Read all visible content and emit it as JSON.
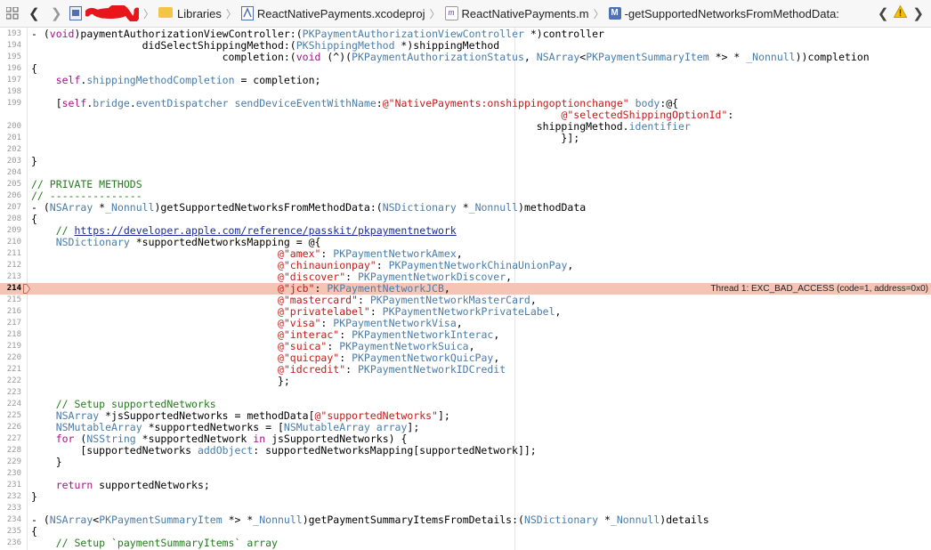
{
  "jumpbar": {
    "breadcrumbs": [
      "Libraries",
      "ReactNativePayments.xcodeproj",
      "ReactNativePayments.m",
      "-getSupportedNetworksFromMethodData:"
    ],
    "separator": "〉"
  },
  "error": {
    "line": "214",
    "message": "Thread 1: EXC_BAD_ACCESS (code=1, address=0x0)"
  },
  "colors": {
    "keyword": "#a7108b",
    "type": "#4a7ca9",
    "string": "#c41a16",
    "comment": "#267a1e",
    "error_highlight": "#f5c4b5"
  },
  "lines": [
    {
      "n": "193",
      "segs": [
        [
          "- (",
          "p"
        ],
        [
          "void",
          "kw"
        ],
        [
          ")paymentAuthorizationViewController:(",
          "p"
        ],
        [
          "PKPaymentAuthorizationViewController",
          "ty"
        ],
        [
          " *)controller",
          "p"
        ]
      ]
    },
    {
      "n": "194",
      "segs": [
        [
          "                  didSelectShippingMethod:(",
          "p"
        ],
        [
          "PKShippingMethod",
          "ty"
        ],
        [
          " *)shippingMethod",
          "p"
        ]
      ]
    },
    {
      "n": "195",
      "segs": [
        [
          "                               completion:(",
          "p"
        ],
        [
          "void",
          "kw"
        ],
        [
          " (^)(",
          "p"
        ],
        [
          "PKPaymentAuthorizationStatus",
          "ty"
        ],
        [
          ", ",
          "p"
        ],
        [
          "NSArray",
          "ty"
        ],
        [
          "<",
          "p"
        ],
        [
          "PKPaymentSummaryItem",
          "ty"
        ],
        [
          " *> * ",
          "p"
        ],
        [
          "_Nonnull",
          "ty"
        ],
        [
          "))completion",
          "p"
        ]
      ]
    },
    {
      "n": "196",
      "segs": [
        [
          "{",
          "p"
        ]
      ]
    },
    {
      "n": "197",
      "segs": [
        [
          "    ",
          "p"
        ],
        [
          "self",
          "kw"
        ],
        [
          ".",
          "p"
        ],
        [
          "shippingMethodCompletion",
          "ty"
        ],
        [
          " = completion;",
          "p"
        ]
      ]
    },
    {
      "n": "198",
      "segs": []
    },
    {
      "n": "199",
      "segs": [
        [
          "    [",
          "p"
        ],
        [
          "self",
          "kw"
        ],
        [
          ".",
          "p"
        ],
        [
          "bridge",
          "ty"
        ],
        [
          ".",
          "p"
        ],
        [
          "eventDispatcher",
          "ty"
        ],
        [
          " ",
          "p"
        ],
        [
          "sendDeviceEventWithName",
          "ty"
        ],
        [
          ":",
          "p"
        ],
        [
          "@\"NativePayments:onshippingoptionchange\"",
          "st"
        ],
        [
          " ",
          "p"
        ],
        [
          "body",
          "ty"
        ],
        [
          ":@{",
          "p"
        ]
      ]
    },
    {
      "n": "",
      "segs": [
        [
          "                                                                                      ",
          "p"
        ],
        [
          "@\"selectedShippingOptionId\"",
          "st"
        ],
        [
          ":",
          "p"
        ]
      ]
    },
    {
      "n": "200",
      "segs": [
        [
          "                                                                                  shippingMethod.",
          "p"
        ],
        [
          "identifier",
          "ty"
        ]
      ]
    },
    {
      "n": "201",
      "segs": [
        [
          "                                                                                      }];",
          "p"
        ]
      ]
    },
    {
      "n": "202",
      "segs": []
    },
    {
      "n": "203",
      "segs": [
        [
          "}",
          "p"
        ]
      ]
    },
    {
      "n": "204",
      "segs": []
    },
    {
      "n": "205",
      "segs": [
        [
          "// PRIVATE METHODS",
          "cm"
        ]
      ]
    },
    {
      "n": "206",
      "segs": [
        [
          "// ---------------",
          "cm"
        ]
      ]
    },
    {
      "n": "207",
      "segs": [
        [
          "- (",
          "p"
        ],
        [
          "NSArray",
          "ty"
        ],
        [
          " *",
          "p"
        ],
        [
          "_Nonnull",
          "ty"
        ],
        [
          ")getSupportedNetworksFromMethodData:(",
          "p"
        ],
        [
          "NSDictionary",
          "ty"
        ],
        [
          " *",
          "p"
        ],
        [
          "_Nonnull",
          "ty"
        ],
        [
          ")methodData",
          "p"
        ]
      ]
    },
    {
      "n": "208",
      "segs": [
        [
          "{",
          "p"
        ]
      ]
    },
    {
      "n": "209",
      "segs": [
        [
          "    // ",
          "cm"
        ],
        [
          "https://developer.apple.com/reference/passkit/pkpaymentnetwork",
          "url"
        ]
      ]
    },
    {
      "n": "210",
      "segs": [
        [
          "    ",
          "p"
        ],
        [
          "NSDictionary",
          "ty"
        ],
        [
          " *supportedNetworksMapping = @{",
          "p"
        ]
      ]
    },
    {
      "n": "211",
      "segs": [
        [
          "                                        ",
          "p"
        ],
        [
          "@\"amex\"",
          "st"
        ],
        [
          ": ",
          "p"
        ],
        [
          "PKPaymentNetworkAmex",
          "ty"
        ],
        [
          ",",
          "p"
        ]
      ]
    },
    {
      "n": "212",
      "segs": [
        [
          "                                        ",
          "p"
        ],
        [
          "@\"chinaunionpay\"",
          "st"
        ],
        [
          ": ",
          "p"
        ],
        [
          "PKPaymentNetworkChinaUnionPay",
          "ty"
        ],
        [
          ",",
          "p"
        ]
      ]
    },
    {
      "n": "213",
      "segs": [
        [
          "                                        ",
          "p"
        ],
        [
          "@\"discover\"",
          "st"
        ],
        [
          ": ",
          "p"
        ],
        [
          "PKPaymentNetworkDiscover",
          "ty"
        ],
        [
          ",",
          "p"
        ]
      ]
    },
    {
      "n": "214",
      "hl": true,
      "segs": [
        [
          "                                        ",
          "p"
        ],
        [
          "@\"jcb\"",
          "st"
        ],
        [
          ": ",
          "p"
        ],
        [
          "PKPaymentNetworkJCB",
          "ty"
        ],
        [
          ",",
          "p"
        ]
      ]
    },
    {
      "n": "215",
      "segs": [
        [
          "                                        ",
          "p"
        ],
        [
          "@\"mastercard\"",
          "st"
        ],
        [
          ": ",
          "p"
        ],
        [
          "PKPaymentNetworkMasterCard",
          "ty"
        ],
        [
          ",",
          "p"
        ]
      ]
    },
    {
      "n": "216",
      "segs": [
        [
          "                                        ",
          "p"
        ],
        [
          "@\"privatelabel\"",
          "st"
        ],
        [
          ": ",
          "p"
        ],
        [
          "PKPaymentNetworkPrivateLabel",
          "ty"
        ],
        [
          ",",
          "p"
        ]
      ]
    },
    {
      "n": "217",
      "segs": [
        [
          "                                        ",
          "p"
        ],
        [
          "@\"visa\"",
          "st"
        ],
        [
          ": ",
          "p"
        ],
        [
          "PKPaymentNetworkVisa",
          "ty"
        ],
        [
          ",",
          "p"
        ]
      ]
    },
    {
      "n": "218",
      "segs": [
        [
          "                                        ",
          "p"
        ],
        [
          "@\"interac\"",
          "st"
        ],
        [
          ": ",
          "p"
        ],
        [
          "PKPaymentNetworkInterac",
          "ty"
        ],
        [
          ",",
          "p"
        ]
      ]
    },
    {
      "n": "219",
      "segs": [
        [
          "                                        ",
          "p"
        ],
        [
          "@\"suica\"",
          "st"
        ],
        [
          ": ",
          "p"
        ],
        [
          "PKPaymentNetworkSuica",
          "ty"
        ],
        [
          ",",
          "p"
        ]
      ]
    },
    {
      "n": "220",
      "segs": [
        [
          "                                        ",
          "p"
        ],
        [
          "@\"quicpay\"",
          "st"
        ],
        [
          ": ",
          "p"
        ],
        [
          "PKPaymentNetworkQuicPay",
          "ty"
        ],
        [
          ",",
          "p"
        ]
      ]
    },
    {
      "n": "221",
      "segs": [
        [
          "                                        ",
          "p"
        ],
        [
          "@\"idcredit\"",
          "st"
        ],
        [
          ": ",
          "p"
        ],
        [
          "PKPaymentNetworkIDCredit",
          "ty"
        ]
      ]
    },
    {
      "n": "222",
      "segs": [
        [
          "                                        };",
          "p"
        ]
      ]
    },
    {
      "n": "223",
      "segs": []
    },
    {
      "n": "224",
      "segs": [
        [
          "    // Setup supportedNetworks",
          "cm"
        ]
      ]
    },
    {
      "n": "225",
      "segs": [
        [
          "    ",
          "p"
        ],
        [
          "NSArray",
          "ty"
        ],
        [
          " *jsSupportedNetworks = methodData[",
          "p"
        ],
        [
          "@\"supportedNetworks\"",
          "st"
        ],
        [
          "];",
          "p"
        ]
      ]
    },
    {
      "n": "226",
      "segs": [
        [
          "    ",
          "p"
        ],
        [
          "NSMutableArray",
          "ty"
        ],
        [
          " *supportedNetworks = [",
          "p"
        ],
        [
          "NSMutableArray",
          "ty"
        ],
        [
          " ",
          "p"
        ],
        [
          "array",
          "ty"
        ],
        [
          "];",
          "p"
        ]
      ]
    },
    {
      "n": "227",
      "segs": [
        [
          "    ",
          "p"
        ],
        [
          "for",
          "kw"
        ],
        [
          " (",
          "p"
        ],
        [
          "NSString",
          "ty"
        ],
        [
          " *supportedNetwork ",
          "p"
        ],
        [
          "in",
          "kw"
        ],
        [
          " jsSupportedNetworks) {",
          "p"
        ]
      ]
    },
    {
      "n": "228",
      "segs": [
        [
          "        [supportedNetworks ",
          "p"
        ],
        [
          "addObject",
          "ty"
        ],
        [
          ": supportedNetworksMapping[supportedNetwork]];",
          "p"
        ]
      ]
    },
    {
      "n": "229",
      "segs": [
        [
          "    }",
          "p"
        ]
      ]
    },
    {
      "n": "230",
      "segs": []
    },
    {
      "n": "231",
      "segs": [
        [
          "    ",
          "p"
        ],
        [
          "return",
          "kw"
        ],
        [
          " supportedNetworks;",
          "p"
        ]
      ]
    },
    {
      "n": "232",
      "segs": [
        [
          "}",
          "p"
        ]
      ]
    },
    {
      "n": "233",
      "segs": []
    },
    {
      "n": "234",
      "segs": [
        [
          "- (",
          "p"
        ],
        [
          "NSArray",
          "ty"
        ],
        [
          "<",
          "p"
        ],
        [
          "PKPaymentSummaryItem",
          "ty"
        ],
        [
          " *> *",
          "p"
        ],
        [
          "_Nonnull",
          "ty"
        ],
        [
          ")getPaymentSummaryItemsFromDetails:(",
          "p"
        ],
        [
          "NSDictionary",
          "ty"
        ],
        [
          " *",
          "p"
        ],
        [
          "_Nonnull",
          "ty"
        ],
        [
          ")details",
          "p"
        ]
      ]
    },
    {
      "n": "235",
      "segs": [
        [
          "{",
          "p"
        ]
      ]
    },
    {
      "n": "236",
      "segs": [
        [
          "    // Setup `paymentSummaryItems` array",
          "cm"
        ]
      ]
    }
  ]
}
